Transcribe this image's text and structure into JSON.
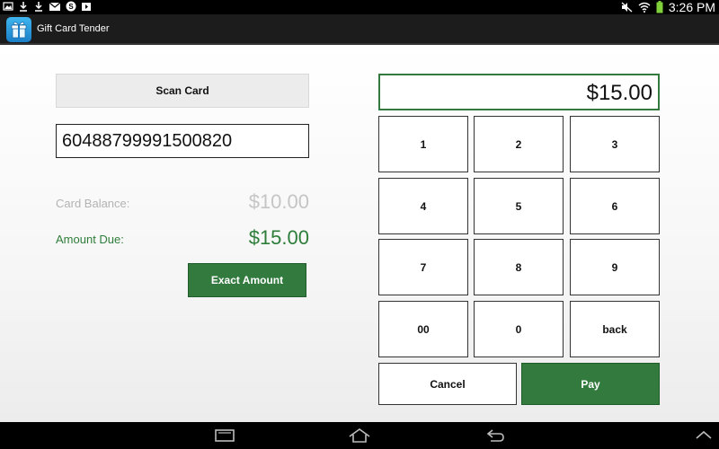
{
  "status_bar": {
    "time": "3:26 PM",
    "left_icons": [
      "image-icon",
      "download-icon",
      "download-icon",
      "mail-icon",
      "skype-icon",
      "play-store-icon"
    ],
    "right_icons": [
      "mute-icon",
      "wifi-icon",
      "battery-icon"
    ]
  },
  "action_bar": {
    "title": "Gift Card Tender",
    "icon": "gift-icon"
  },
  "left_panel": {
    "scan_label": "Scan Card",
    "card_number": "60488799991500820",
    "balance_label": "Card Balance:",
    "balance_value": "$10.00",
    "due_label": "Amount Due:",
    "due_value": "$15.00",
    "exact_label": "Exact Amount"
  },
  "keypad": {
    "display": "$15.00",
    "keys": [
      "1",
      "2",
      "3",
      "4",
      "5",
      "6",
      "7",
      "8",
      "9",
      "00",
      "0",
      "back"
    ],
    "cancel_label": "Cancel",
    "pay_label": "Pay"
  },
  "colors": {
    "accent_green": "#327a3e",
    "muted_gray": "#c5c5c5"
  },
  "nav_bar": {
    "icons": [
      "recent-apps-icon",
      "home-icon",
      "back-icon",
      "collapse-icon"
    ]
  }
}
